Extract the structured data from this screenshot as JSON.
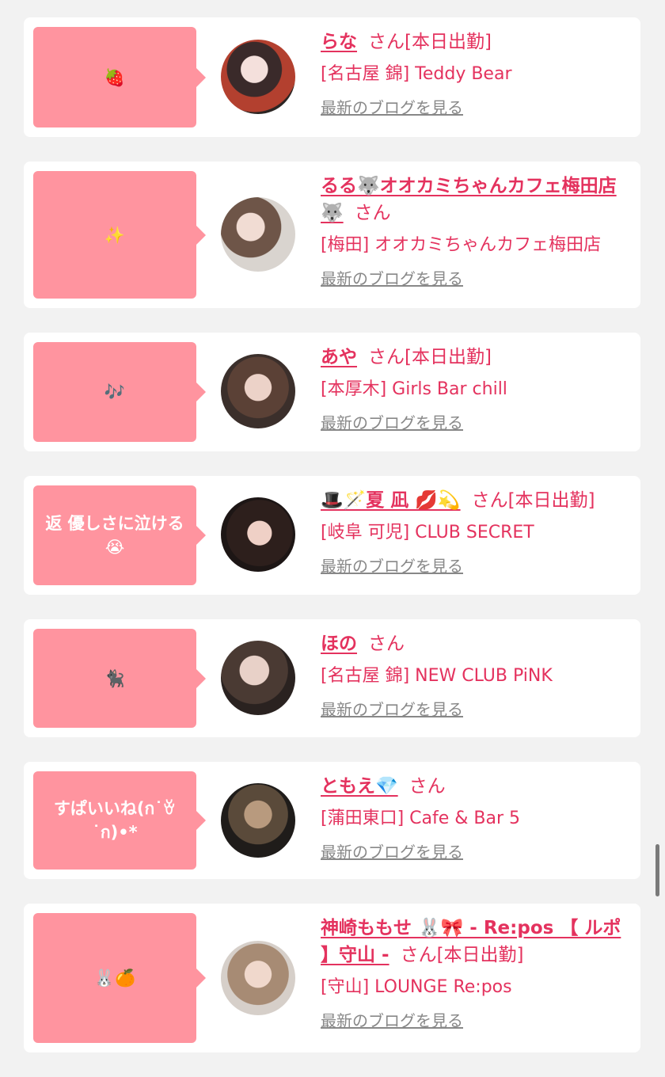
{
  "posts": [
    {
      "comment": "🍓",
      "name": "らな",
      "san": "さん[本日出勤]",
      "shop": "[名古屋 錦] Teddy Bear",
      "blog": "最新のブログを見る"
    },
    {
      "comment": "✨",
      "name": "るる🐺オオカミちゃんカフェ梅田店🐺",
      "san": "さん",
      "shop": "[梅田] オオカミちゃんカフェ梅田店",
      "blog": "最新のブログを見る"
    },
    {
      "comment": "🎶",
      "name": "あや",
      "san": "さん[本日出勤]",
      "shop": "[本厚木] Girls Bar chill",
      "blog": "最新のブログを見る"
    },
    {
      "comment": "返 優しさに泣ける😭",
      "name": "🎩🪄夏 凪 💋💫",
      "san": "さん[本日出勤]",
      "shop": "[岐阜 可児] CLUB SECRET",
      "blog": "最新のブログを見る"
    },
    {
      "comment": "🐈‍⬛",
      "name": "ほの",
      "san": "さん",
      "shop": "[名古屋 錦] NEW CLUB PiNK",
      "blog": "最新のブログを見る"
    },
    {
      "comment": "すぱいいね(ก˙ꈊ˙ก)•*",
      "name": "ともえ💎",
      "san": "さん",
      "shop": "[蒲田東口] Cafe & Bar 5",
      "blog": "最新のブログを見る"
    },
    {
      "comment": "🐰🍊",
      "name": "神崎ももせ 🐰🎀 - Re:pos 【 ルポ 】守山 -",
      "san": "さん[本日出勤]",
      "shop": "[守山] LOUNGE Re:pos",
      "blog": "最新のブログを見る"
    }
  ],
  "colors": {
    "accent": "#e4325e",
    "bubble": "#ff949f",
    "background": "#f2f2f2"
  }
}
